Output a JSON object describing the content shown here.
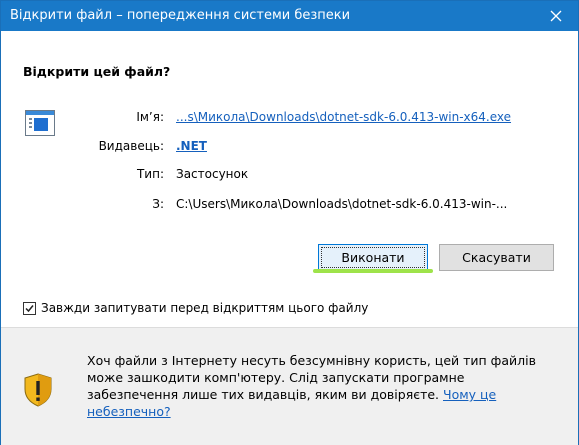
{
  "window": {
    "title": "Відкрити файл – попередження системи безпеки",
    "close_glyph": "✕"
  },
  "heading": "Відкрити цей файл?",
  "fields": {
    "name_label": "Ім’я:",
    "name_value": "...s\\Микола\\Downloads\\dotnet-sdk-6.0.413-win-x64.exe",
    "publisher_label": "Видавець:",
    "publisher_value": ".NET",
    "type_label": "Тип:",
    "type_value": "Застосунок",
    "from_label": "З:",
    "from_value": "C:\\Users\\Микола\\Downloads\\dotnet-sdk-6.0.413-win-..."
  },
  "buttons": {
    "run": "Виконати",
    "cancel": "Скасувати"
  },
  "checkbox": {
    "label": "Завжди запитувати перед відкриттям цього файлу",
    "checked": true
  },
  "warning": {
    "text": "Хоч файли з Інтернету несуть безсумнівну користь, цей тип файлів може зашкодити комп'ютеру. Слід запускати програмне забезпечення лише тих видавців, яким ви довіряєте. ",
    "link": "Чому це небезпечно?"
  },
  "colors": {
    "titlebar": "#1979c8",
    "link": "#1560bd",
    "shield": "#f2b81e"
  },
  "icons": {
    "file": "application-window-icon",
    "close": "close-icon",
    "shield": "shield-warning-icon"
  }
}
